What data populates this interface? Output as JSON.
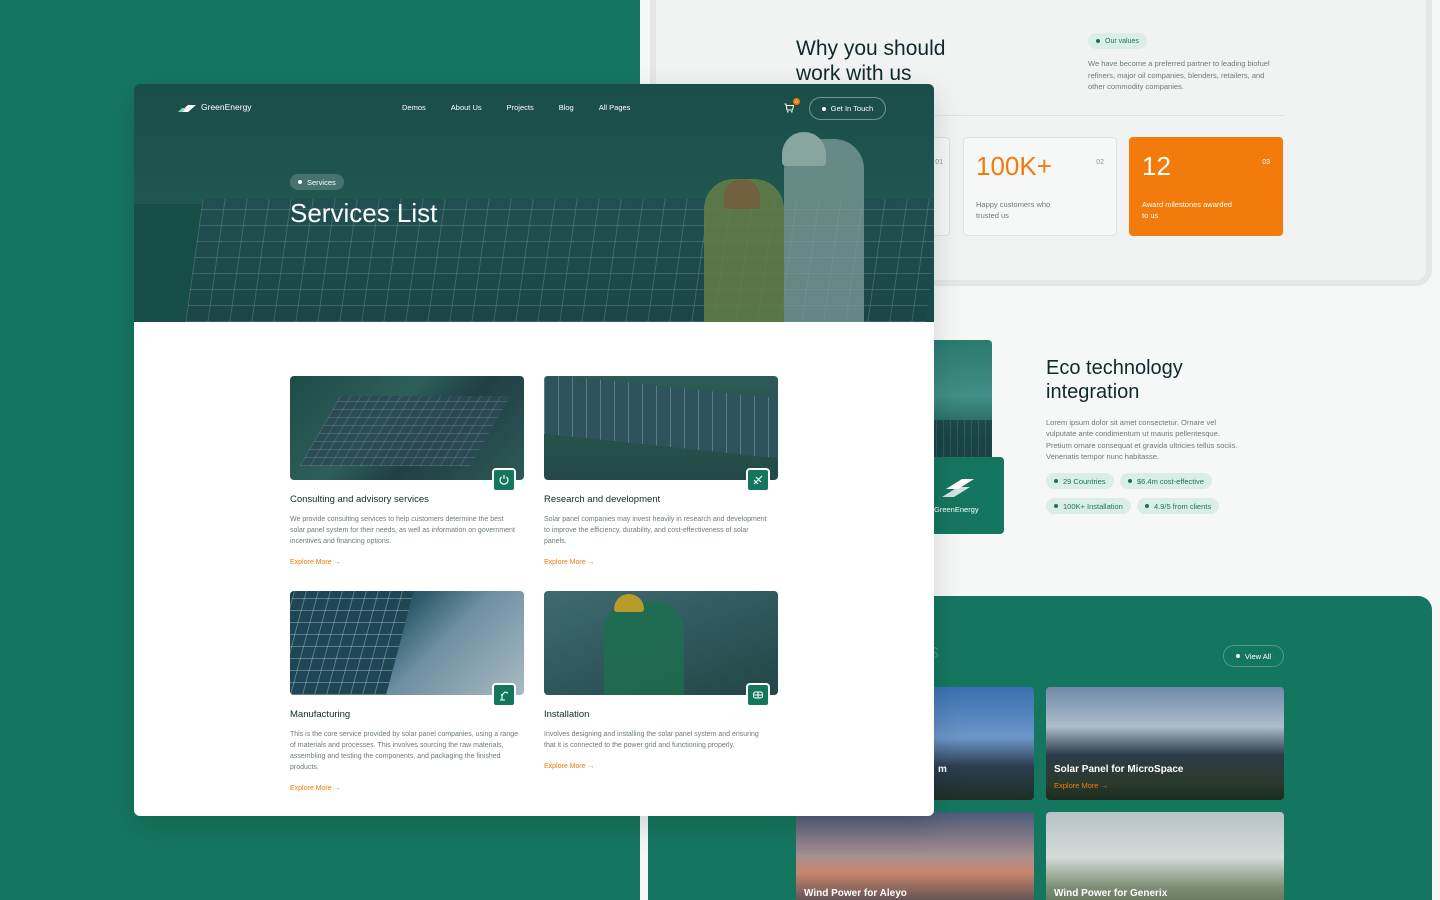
{
  "colors": {
    "brand_green": "#15765f",
    "accent_orange": "#f27b0c",
    "dark_text": "#0f2a2a"
  },
  "nav": {
    "logo_text": "GreenEnergy",
    "menu": [
      "Demos",
      "About Us",
      "Projects",
      "Blog",
      "All Pages"
    ],
    "cart_count": "0",
    "cta_label": "Get In Touch",
    "icons": {
      "cart": "cart-icon"
    }
  },
  "hero": {
    "pill": "Services",
    "title": "Services List"
  },
  "services": [
    {
      "title": "Consulting and advisory services",
      "desc": "We provide consulting services to help customers determine the best solar panel system for their needs, as well as information on government incentives and financing options.",
      "more": "Explore More",
      "icon": "power-icon"
    },
    {
      "title": "Research and development",
      "desc": "Solar panel companies may invest heavily in research and development to improve the efficiency, durability, and cost-effectiveness of solar panels.",
      "more": "Explore More",
      "icon": "satellite-icon"
    },
    {
      "title": "Manufacturing",
      "desc": "This is the core service provided by solar panel companies, using a range of materials and processes. This involves sourcing the raw materials, assembling and testing the components, and packaging the finished products.",
      "more": "Explore More",
      "icon": "robot-arm-icon"
    },
    {
      "title": "Installation",
      "desc": "Involves designing and installing the solar panel system and ensuring that it is connected to the power grid and functioning properly.",
      "more": "Explore More",
      "icon": "panel-icon"
    }
  ],
  "why": {
    "title": "Why you should work with us",
    "pill": "Our values",
    "desc": "We have become a preferred partner to leading biofuel refiners, major oil companies, blenders, retailers, and other commodity companies.",
    "stats": [
      {
        "num": "",
        "idx": "01",
        "label": ""
      },
      {
        "num": "100K+",
        "idx": "02",
        "label": "Happy customers who trusted us"
      },
      {
        "num": "12",
        "idx": "03",
        "label": "Award milestones awarded to us"
      }
    ]
  },
  "eco": {
    "badge_text": "GreenEnergy",
    "title": "Eco technology integration",
    "desc": "Lorem ipsum dolor sit amet consectetur. Ornare vel vulputate ante condimentum ut mauris pellentesque. Pretium ornare consequat et gravida ultricies tellus sociis. Venenatis tempor nunc habitasse.",
    "tags": [
      "29 Countries",
      "$6.4m cost-effective",
      "100K+ Installation",
      "4.9/5 from clients"
    ]
  },
  "projects": {
    "view_all": "View All",
    "heading_fragment": "s",
    "items": [
      {
        "title": "m",
        "more": ""
      },
      {
        "title": "Solar Panel for MicroSpace",
        "more": "Explore More"
      },
      {
        "title": "Wind Power for Aleyo",
        "more": ""
      },
      {
        "title": "Wind Power for Generix",
        "more": ""
      }
    ]
  }
}
